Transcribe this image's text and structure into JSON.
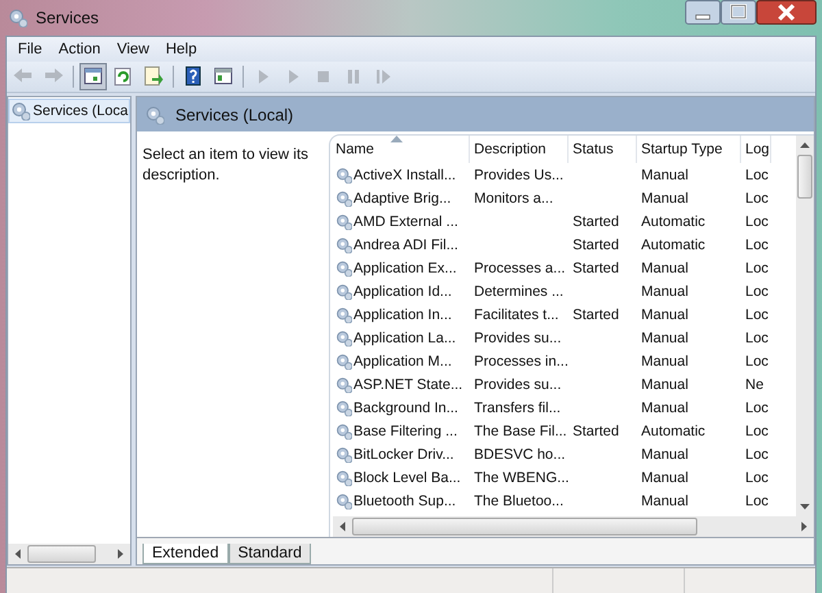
{
  "window": {
    "title": "Services"
  },
  "menu": [
    "File",
    "Action",
    "View",
    "Help"
  ],
  "toolbar": [
    {
      "kind": "back",
      "disabled": true,
      "pressed": false
    },
    {
      "kind": "forward",
      "disabled": true,
      "pressed": false
    },
    {
      "kind": "sep"
    },
    {
      "kind": "tree",
      "disabled": false,
      "pressed": true
    },
    {
      "kind": "refresh",
      "disabled": false,
      "pressed": false
    },
    {
      "kind": "export",
      "disabled": false,
      "pressed": false
    },
    {
      "kind": "sep"
    },
    {
      "kind": "help",
      "disabled": false,
      "pressed": false
    },
    {
      "kind": "pane",
      "disabled": false,
      "pressed": false
    },
    {
      "kind": "sep"
    },
    {
      "kind": "start",
      "disabled": true,
      "pressed": false
    },
    {
      "kind": "start",
      "disabled": true,
      "pressed": false
    },
    {
      "kind": "stop",
      "disabled": true,
      "pressed": false
    },
    {
      "kind": "pause",
      "disabled": true,
      "pressed": false
    },
    {
      "kind": "resume",
      "disabled": true,
      "pressed": false
    }
  ],
  "tree": {
    "items": [
      {
        "label": "Services (Loca",
        "selected": true
      }
    ]
  },
  "header": {
    "title": "Services (Local)"
  },
  "description": "Select an item to view its description.",
  "table": {
    "columns": [
      "Name",
      "Description",
      "Status",
      "Startup Type",
      "Log"
    ],
    "rows": [
      {
        "name": "ActiveX Install...",
        "description": "Provides Us...",
        "startup": "Manual",
        "log": "Loc"
      },
      {
        "name": "Adaptive Brig...",
        "description": "Monitors a...",
        "startup": "Manual",
        "log": "Loc"
      },
      {
        "name": "AMD External ...",
        "status": "Started",
        "startup": "Automatic",
        "log": "Loc"
      },
      {
        "name": "Andrea ADI Fil...",
        "status": "Started",
        "startup": "Automatic",
        "log": "Loc"
      },
      {
        "name": "Application Ex...",
        "description": "Processes a...",
        "status": "Started",
        "startup": "Manual",
        "log": "Loc"
      },
      {
        "name": "Application Id...",
        "description": "Determines ...",
        "startup": "Manual",
        "log": "Loc"
      },
      {
        "name": "Application In...",
        "description": "Facilitates t...",
        "status": "Started",
        "startup": "Manual",
        "log": "Loc"
      },
      {
        "name": "Application La...",
        "description": "Provides su...",
        "startup": "Manual",
        "log": "Loc"
      },
      {
        "name": "Application M...",
        "description": "Processes in...",
        "startup": "Manual",
        "log": "Loc"
      },
      {
        "name": "ASP.NET State...",
        "description": "Provides su...",
        "startup": "Manual",
        "log": "Ne"
      },
      {
        "name": "Background In...",
        "description": "Transfers fil...",
        "startup": "Manual",
        "log": "Loc"
      },
      {
        "name": "Base Filtering ...",
        "description": "The Base Fil...",
        "status": "Started",
        "startup": "Automatic",
        "log": "Loc"
      },
      {
        "name": "BitLocker Driv...",
        "description": "BDESVC ho...",
        "startup": "Manual",
        "log": "Loc"
      },
      {
        "name": "Block Level Ba...",
        "description": "The WBENG...",
        "startup": "Manual",
        "log": "Loc"
      },
      {
        "name": "Bluetooth Sup...",
        "description": "The Bluetoo...",
        "startup": "Manual",
        "log": "Loc"
      }
    ]
  },
  "tabs": [
    {
      "label": "Extended",
      "selected": true
    },
    {
      "label": "Standard",
      "selected": false
    }
  ]
}
